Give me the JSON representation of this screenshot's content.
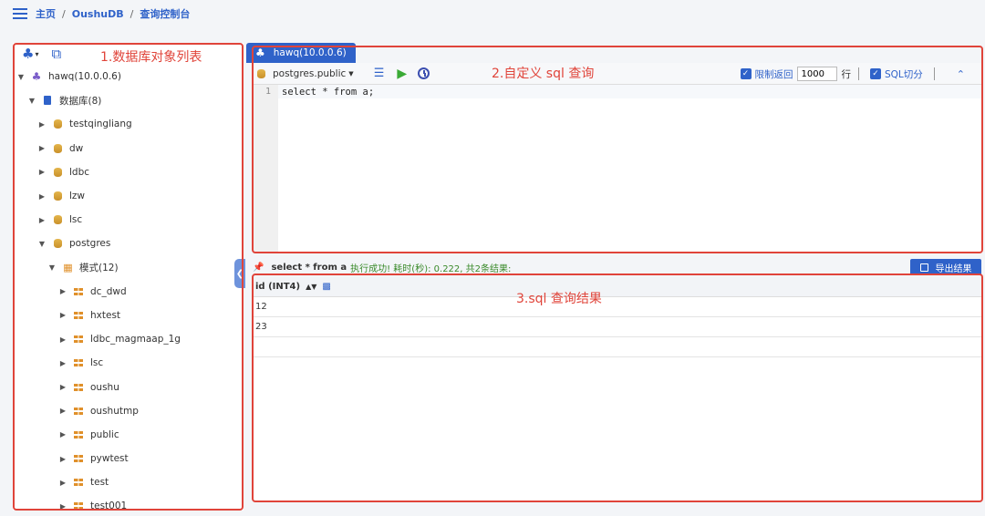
{
  "breadcrumb": {
    "home": "主页",
    "db": "OushuDB",
    "page": "查询控制台",
    "separator": "/"
  },
  "annotations": {
    "left": "1.数据库对象列表",
    "editor": "2.自定义 sql 查询",
    "results": "3.sql 查询结果"
  },
  "tree": {
    "server": "hawq(10.0.0.6)",
    "databases": "数据库(8)",
    "db_items": [
      "testqingliang",
      "dw",
      "ldbc",
      "lzw",
      "lsc",
      "postgres"
    ],
    "schemas": "模式(12)",
    "schema_items": [
      "dc_dwd",
      "hxtest",
      "ldbc_magmaap_1g",
      "lsc",
      "oushu",
      "oushutmp",
      "public",
      "pywtest",
      "test",
      "test001"
    ]
  },
  "tab": {
    "label": "hawq(10.0.0.6)"
  },
  "editor": {
    "schema": "postgres.public",
    "limit_label": "限制返回",
    "limit_value": "1000",
    "limit_unit": "行",
    "split_label": "SQL切分",
    "line_no": "1",
    "code": "select * from a;"
  },
  "status": {
    "sql": "select * from a",
    "message": "执行成功! 耗时(秒): 0.222,  共2条结果:",
    "export": "导出结果"
  },
  "results": {
    "column": "id (INT4)",
    "rows": [
      "12",
      "23"
    ]
  },
  "colors": {
    "accent": "#2f62c9",
    "annotation": "#e0443a",
    "success": "#3a8a2a"
  }
}
